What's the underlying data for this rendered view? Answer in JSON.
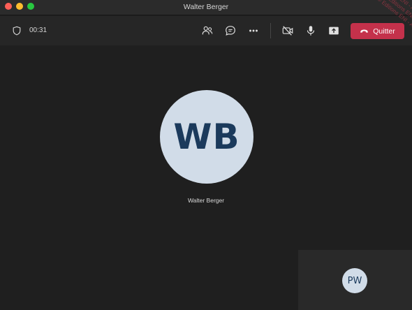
{
  "window": {
    "title": "Walter Berger"
  },
  "toolbar": {
    "timer": "00:31",
    "leave_label": "Quitter",
    "leave_color": "#c4314b",
    "icons": [
      "shield-icon",
      "participants-icon",
      "chat-icon",
      "more-icon",
      "camera-off-icon",
      "microphone-icon",
      "share-screen-icon",
      "hang-up-icon"
    ]
  },
  "main_participant": {
    "initials": "WB",
    "name": "Walter Berger"
  },
  "self_view": {
    "initials": "PW"
  },
  "watermark": {
    "lines": [
      "© Editions ENI - All rights reserved",
      "Editions ENI - All rights reserved",
      "ENI - All rights reserved"
    ]
  }
}
